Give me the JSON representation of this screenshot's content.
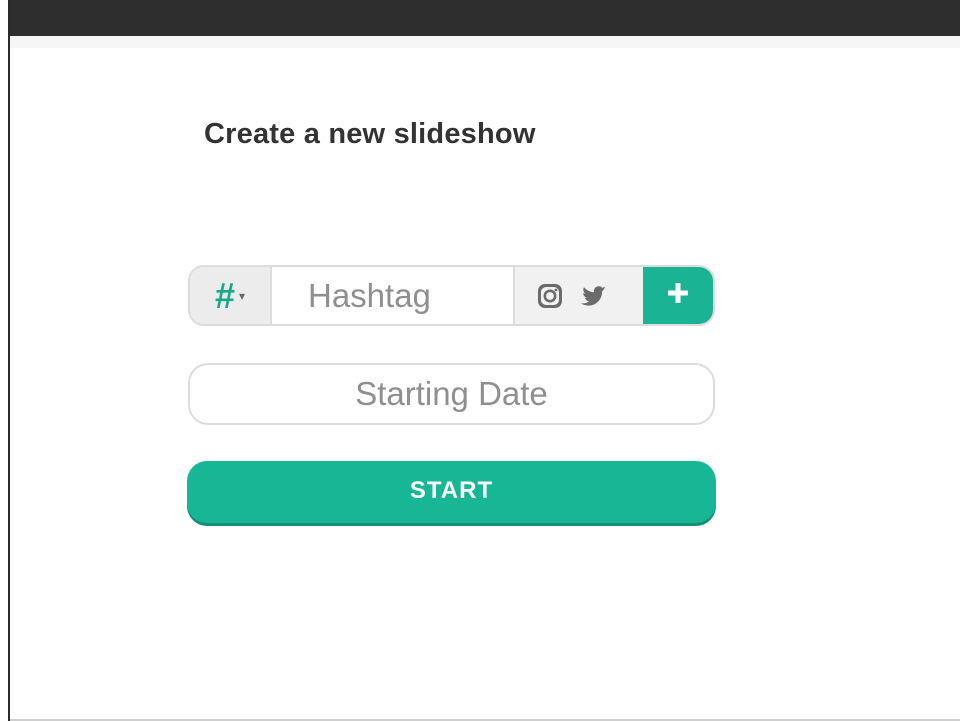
{
  "page": {
    "title": "Create a new slideshow"
  },
  "hashtag": {
    "type_symbol": "#",
    "caret": "▾",
    "placeholder": "Hashtag",
    "value": "",
    "networks": [
      {
        "name": "instagram",
        "icon": "instagram-icon"
      },
      {
        "name": "twitter",
        "icon": "twitter-icon"
      }
    ],
    "add_icon": "plus-icon"
  },
  "date": {
    "placeholder": "Starting Date",
    "value": ""
  },
  "actions": {
    "start_label": "START"
  },
  "colors": {
    "accent": "#1ab394",
    "title_text": "#333333",
    "placeholder_text": "#8f8f8f",
    "border": "#dcdcdc",
    "top_bar": "#2e2e2e"
  }
}
